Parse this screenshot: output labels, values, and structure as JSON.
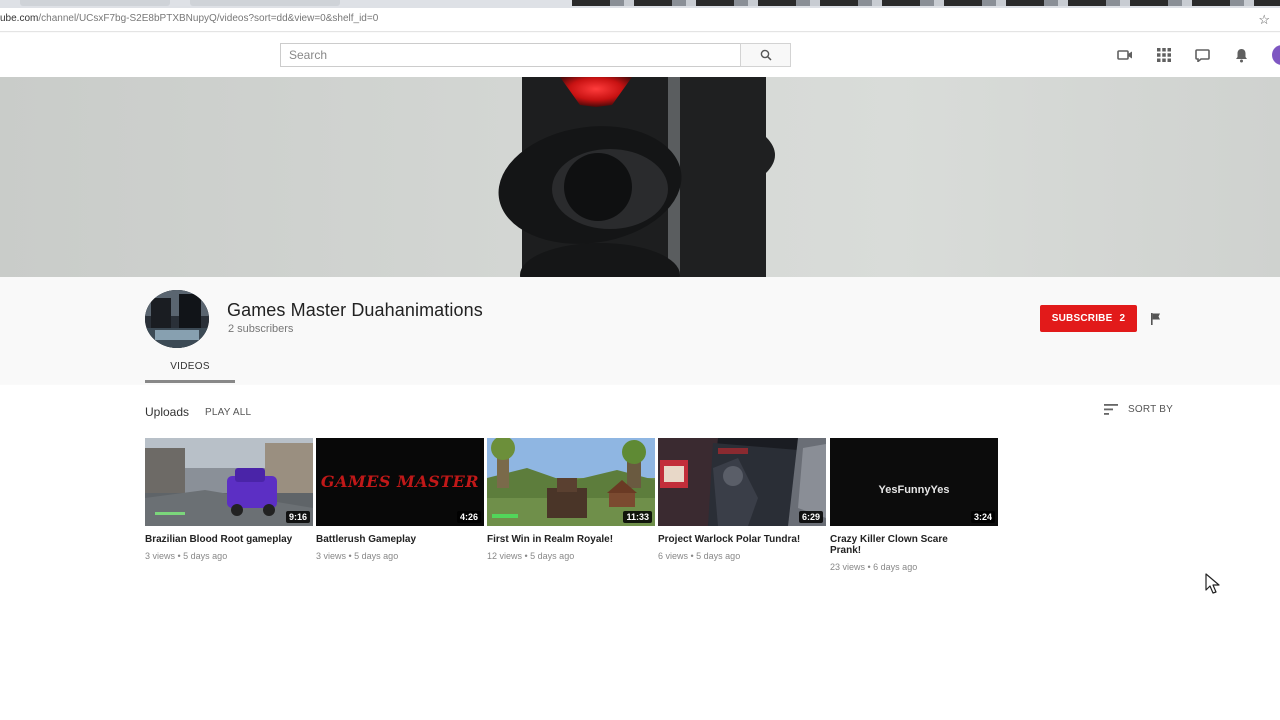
{
  "browser": {
    "url_host": "ube.com",
    "url_path": "/channel/UCsxF7bg-S2E8bPTXBNupyQ/videos?sort=dd&view=0&shelf_id=0"
  },
  "masthead": {
    "search_placeholder": "Search"
  },
  "channel": {
    "name": "Games Master Duahanimations",
    "subscribers": "2 subscribers",
    "subscribe_label": "SUBSCRIBE",
    "subscribe_count": "2",
    "tab_videos": "VIDEOS"
  },
  "uploads": {
    "heading": "Uploads",
    "play_all": "PLAY ALL",
    "sort_by": "SORT BY"
  },
  "videos": [
    {
      "title": "Brazilian Blood Root gameplay",
      "meta": "3 views • 5 days ago",
      "duration": "9:16"
    },
    {
      "title": "Battlerush Gameplay",
      "meta": "3 views • 5 days ago",
      "duration": "4:26",
      "thumb_text": "GAMES MASTER"
    },
    {
      "title": "First Win in Realm Royale!",
      "meta": "12 views • 5 days ago",
      "duration": "11:33"
    },
    {
      "title": "Project Warlock Polar Tundra!",
      "meta": "6 views • 5 days ago",
      "duration": "6:29"
    },
    {
      "title": "Crazy Killer Clown Scare Prank!",
      "meta": "23 views • 6 days ago",
      "duration": "3:24",
      "thumb_text": "YesFunnyYes"
    }
  ],
  "icons": [
    "search-icon",
    "video-camera-icon",
    "apps-grid-icon",
    "messages-icon",
    "bell-icon",
    "flag-icon",
    "sort-icon",
    "bookmark-star-icon",
    "mouse-cursor-icon"
  ],
  "colors": {
    "subscribe": "#e21a1a",
    "banner_light": "#d3d6d3",
    "traffic_light": "#1e1f20",
    "signal_red": "#ff2a2a"
  }
}
